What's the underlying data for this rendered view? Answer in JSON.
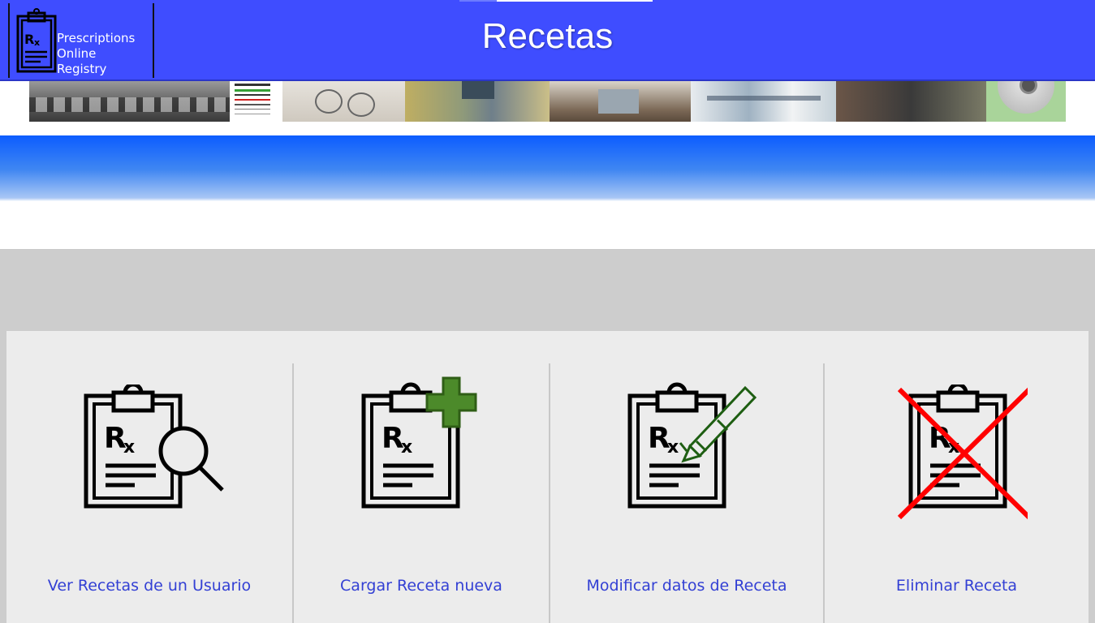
{
  "header": {
    "title": "Recetas",
    "background_color": "#3f4dff",
    "logo": {
      "icon": "clipboard-rx-icon",
      "lines": [
        "Prescriptions",
        "Online",
        "Registry"
      ]
    }
  },
  "banner": {
    "photos": [
      "lens-trays-photo",
      "eye-chart-photo",
      "eyeglasses-photo",
      "eye-exam-photo",
      "optometry-room-photo",
      "optical-lab-photo",
      "glasses-adjustment-photo",
      "contact-lens-photo"
    ]
  },
  "actions": [
    {
      "label": "Ver Recetas de un Usuario",
      "icon": "clipboard-rx-magnifier-icon"
    },
    {
      "label": "Cargar Receta nueva",
      "icon": "clipboard-rx-plus-icon"
    },
    {
      "label": "Modificar datos de Receta",
      "icon": "clipboard-rx-pencil-icon"
    },
    {
      "label": "Eliminar Receta",
      "icon": "clipboard-rx-delete-icon"
    }
  ],
  "colors": {
    "link": "#3340d4",
    "plus_green": "#4c8a2a",
    "delete_red": "#ff0000",
    "pencil_green": "#1e5e12"
  }
}
